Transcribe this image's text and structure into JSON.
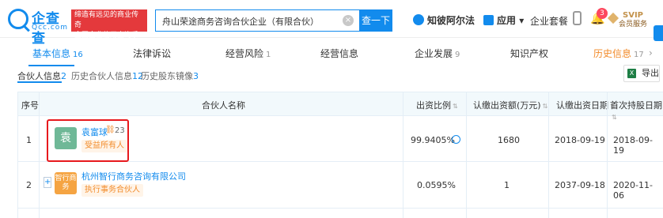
{
  "header": {
    "logo_text": "企查查",
    "logo_sub": "Qcc.com",
    "slogan_line1": "缔造有远见的商业传奇",
    "slogan_line2": "全国企业信用查询系统",
    "search_value": "舟山荣途商务咨询合伙企业（有限合伙）",
    "search_button": "查一下",
    "nav_zhibo": "知彼阿尔法",
    "nav_app": "应用",
    "nav_suite": "企业套餐",
    "bell_count": "3",
    "vip_title": "SVIP",
    "vip_sub": "会员服务"
  },
  "tabs": [
    {
      "label": "基本信息",
      "count": "16"
    },
    {
      "label": "法律诉讼",
      "count": ""
    },
    {
      "label": "经营风险",
      "count": "1"
    },
    {
      "label": "经营信息",
      "count": ""
    },
    {
      "label": "企业发展",
      "count": "9"
    },
    {
      "label": "知识产权",
      "count": ""
    },
    {
      "label": "历史信息",
      "count": "17"
    }
  ],
  "subtabs": [
    {
      "label": "合伙人信息",
      "count": "2"
    },
    {
      "label": "历史合伙人信息",
      "count": "12"
    },
    {
      "label": "历史股东镜像",
      "count": "3"
    }
  ],
  "export_label": "导出",
  "table": {
    "headers": [
      "序号",
      "合伙人名称",
      "出资比例",
      "认缴出资额(万元)",
      "认缴出资日期",
      "首次持股日期"
    ],
    "rows": [
      {
        "index": "1",
        "avatar": "袁",
        "name": "袁富球",
        "tag_count": "23",
        "badge": "受益所有人",
        "ratio": "99.9405%",
        "amount": "1680",
        "date": "2018-09-19",
        "first_date": "2018-09-19"
      },
      {
        "index": "2",
        "avatar": "智行商务",
        "name": "杭州智行商务咨询有限公司",
        "tag_count": "",
        "badge": "执行事务合伙人",
        "ratio": "0.0595%",
        "amount": "1",
        "date": "2037-09-18",
        "first_date": "2020-11-06"
      }
    ]
  }
}
